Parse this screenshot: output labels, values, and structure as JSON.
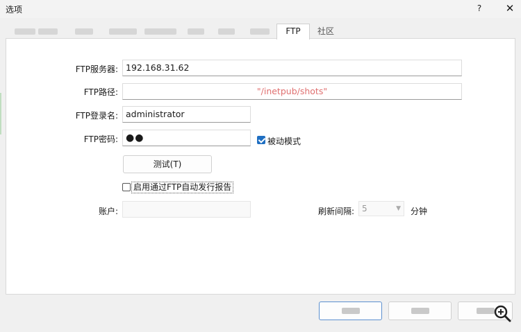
{
  "window": {
    "title": "选项",
    "help": "?",
    "close": "✕"
  },
  "tabs": [
    {
      "label": "",
      "active": false
    },
    {
      "label": "",
      "active": false
    },
    {
      "label": "",
      "active": false
    },
    {
      "label": "",
      "active": false
    },
    {
      "label": "",
      "active": false
    },
    {
      "label": "",
      "active": false
    },
    {
      "label": "",
      "active": false
    },
    {
      "label": "FTP",
      "active": true
    },
    {
      "label": "社区",
      "active": false
    }
  ],
  "form": {
    "server_label": "FTP服务器:",
    "server_value": "192.168.31.62",
    "path_label": "FTP路径:",
    "path_value": "\"/inetpub/shots\"",
    "login_label": "FTP登录名:",
    "login_value": "administrator",
    "password_label": "FTP密码:",
    "password_value": "●●",
    "passive_label": "被动模式",
    "passive_checked": true,
    "test_button": "测试(T)",
    "enable_label": "启用通过FTP自动发行报告",
    "enable_checked": false,
    "account_label": "账户:",
    "account_value": "",
    "refresh_label": "刷新间隔:",
    "refresh_value": "5",
    "refresh_unit": "分钟"
  },
  "footer": {
    "ok": "",
    "cancel": "",
    "apply": ""
  },
  "icons": {
    "zoom": "zoom-in-icon"
  }
}
